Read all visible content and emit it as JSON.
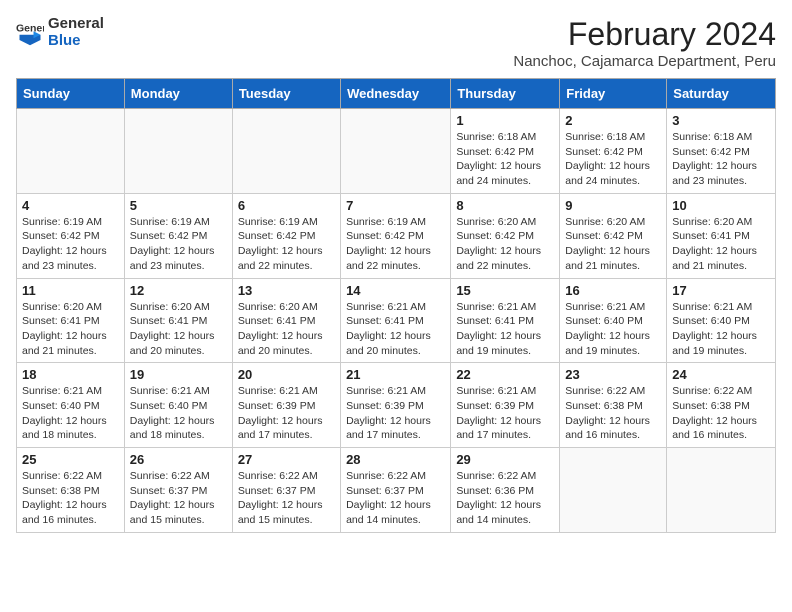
{
  "header": {
    "logo_general": "General",
    "logo_blue": "Blue",
    "month_title": "February 2024",
    "location": "Nanchoc, Cajamarca Department, Peru"
  },
  "days_of_week": [
    "Sunday",
    "Monday",
    "Tuesday",
    "Wednesday",
    "Thursday",
    "Friday",
    "Saturday"
  ],
  "weeks": [
    [
      {
        "day": "",
        "info": ""
      },
      {
        "day": "",
        "info": ""
      },
      {
        "day": "",
        "info": ""
      },
      {
        "day": "",
        "info": ""
      },
      {
        "day": "1",
        "info": "Sunrise: 6:18 AM\nSunset: 6:42 PM\nDaylight: 12 hours and 24 minutes."
      },
      {
        "day": "2",
        "info": "Sunrise: 6:18 AM\nSunset: 6:42 PM\nDaylight: 12 hours and 24 minutes."
      },
      {
        "day": "3",
        "info": "Sunrise: 6:18 AM\nSunset: 6:42 PM\nDaylight: 12 hours and 23 minutes."
      }
    ],
    [
      {
        "day": "4",
        "info": "Sunrise: 6:19 AM\nSunset: 6:42 PM\nDaylight: 12 hours and 23 minutes."
      },
      {
        "day": "5",
        "info": "Sunrise: 6:19 AM\nSunset: 6:42 PM\nDaylight: 12 hours and 23 minutes."
      },
      {
        "day": "6",
        "info": "Sunrise: 6:19 AM\nSunset: 6:42 PM\nDaylight: 12 hours and 22 minutes."
      },
      {
        "day": "7",
        "info": "Sunrise: 6:19 AM\nSunset: 6:42 PM\nDaylight: 12 hours and 22 minutes."
      },
      {
        "day": "8",
        "info": "Sunrise: 6:20 AM\nSunset: 6:42 PM\nDaylight: 12 hours and 22 minutes."
      },
      {
        "day": "9",
        "info": "Sunrise: 6:20 AM\nSunset: 6:42 PM\nDaylight: 12 hours and 21 minutes."
      },
      {
        "day": "10",
        "info": "Sunrise: 6:20 AM\nSunset: 6:41 PM\nDaylight: 12 hours and 21 minutes."
      }
    ],
    [
      {
        "day": "11",
        "info": "Sunrise: 6:20 AM\nSunset: 6:41 PM\nDaylight: 12 hours and 21 minutes."
      },
      {
        "day": "12",
        "info": "Sunrise: 6:20 AM\nSunset: 6:41 PM\nDaylight: 12 hours and 20 minutes."
      },
      {
        "day": "13",
        "info": "Sunrise: 6:20 AM\nSunset: 6:41 PM\nDaylight: 12 hours and 20 minutes."
      },
      {
        "day": "14",
        "info": "Sunrise: 6:21 AM\nSunset: 6:41 PM\nDaylight: 12 hours and 20 minutes."
      },
      {
        "day": "15",
        "info": "Sunrise: 6:21 AM\nSunset: 6:41 PM\nDaylight: 12 hours and 19 minutes."
      },
      {
        "day": "16",
        "info": "Sunrise: 6:21 AM\nSunset: 6:40 PM\nDaylight: 12 hours and 19 minutes."
      },
      {
        "day": "17",
        "info": "Sunrise: 6:21 AM\nSunset: 6:40 PM\nDaylight: 12 hours and 19 minutes."
      }
    ],
    [
      {
        "day": "18",
        "info": "Sunrise: 6:21 AM\nSunset: 6:40 PM\nDaylight: 12 hours and 18 minutes."
      },
      {
        "day": "19",
        "info": "Sunrise: 6:21 AM\nSunset: 6:40 PM\nDaylight: 12 hours and 18 minutes."
      },
      {
        "day": "20",
        "info": "Sunrise: 6:21 AM\nSunset: 6:39 PM\nDaylight: 12 hours and 17 minutes."
      },
      {
        "day": "21",
        "info": "Sunrise: 6:21 AM\nSunset: 6:39 PM\nDaylight: 12 hours and 17 minutes."
      },
      {
        "day": "22",
        "info": "Sunrise: 6:21 AM\nSunset: 6:39 PM\nDaylight: 12 hours and 17 minutes."
      },
      {
        "day": "23",
        "info": "Sunrise: 6:22 AM\nSunset: 6:38 PM\nDaylight: 12 hours and 16 minutes."
      },
      {
        "day": "24",
        "info": "Sunrise: 6:22 AM\nSunset: 6:38 PM\nDaylight: 12 hours and 16 minutes."
      }
    ],
    [
      {
        "day": "25",
        "info": "Sunrise: 6:22 AM\nSunset: 6:38 PM\nDaylight: 12 hours and 16 minutes."
      },
      {
        "day": "26",
        "info": "Sunrise: 6:22 AM\nSunset: 6:37 PM\nDaylight: 12 hours and 15 minutes."
      },
      {
        "day": "27",
        "info": "Sunrise: 6:22 AM\nSunset: 6:37 PM\nDaylight: 12 hours and 15 minutes."
      },
      {
        "day": "28",
        "info": "Sunrise: 6:22 AM\nSunset: 6:37 PM\nDaylight: 12 hours and 14 minutes."
      },
      {
        "day": "29",
        "info": "Sunrise: 6:22 AM\nSunset: 6:36 PM\nDaylight: 12 hours and 14 minutes."
      },
      {
        "day": "",
        "info": ""
      },
      {
        "day": "",
        "info": ""
      }
    ]
  ]
}
